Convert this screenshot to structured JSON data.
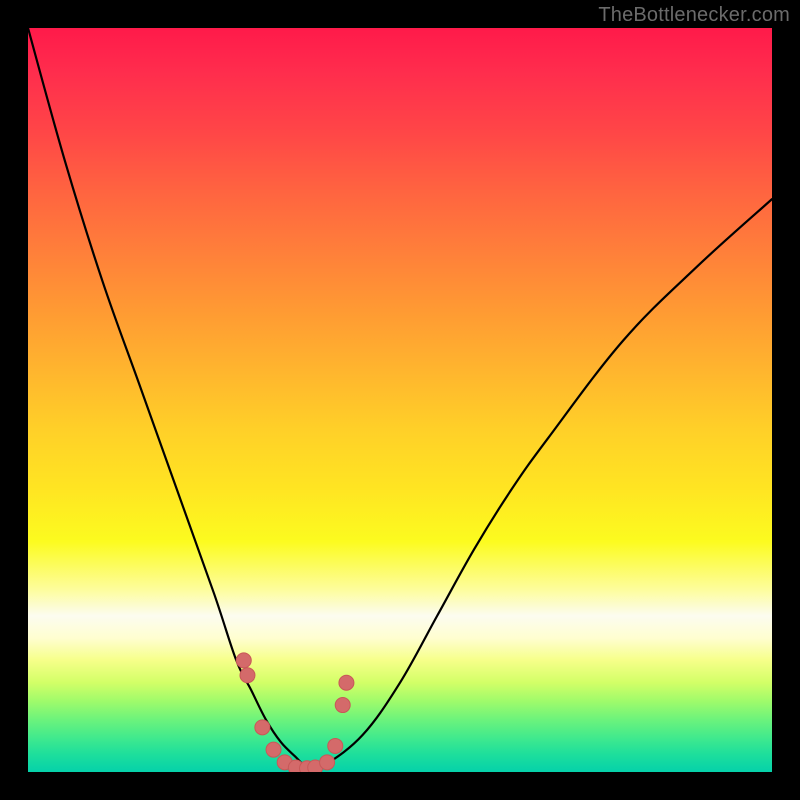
{
  "watermark": {
    "text": "TheBottlenecker.com"
  },
  "colors": {
    "curve_stroke": "#000000",
    "marker_fill": "#d46a6a",
    "marker_stroke": "#c85858",
    "frame_bg": "#000000"
  },
  "chart_data": {
    "type": "line",
    "title": "",
    "xlabel": "",
    "ylabel": "",
    "xlim": [
      0,
      100
    ],
    "ylim": [
      0,
      100
    ],
    "grid": false,
    "legend": false,
    "description": "V-shaped bottleneck curve on vertical rainbow gradient (red top → green bottom). Curve minimum sits near bottom center; salmon markers cluster near the trough.",
    "series": [
      {
        "name": "bottleneck-curve",
        "x": [
          0,
          5,
          10,
          15,
          20,
          25,
          28,
          30,
          32,
          34,
          36,
          37,
          38,
          40,
          45,
          50,
          55,
          60,
          65,
          70,
          80,
          90,
          100
        ],
        "y": [
          100,
          82,
          66,
          52,
          38,
          24,
          15,
          11,
          7,
          4,
          2,
          1,
          0.5,
          1,
          5,
          12,
          21,
          30,
          38,
          45,
          58,
          68,
          77
        ]
      }
    ],
    "markers": {
      "name": "trough-markers",
      "x": [
        29.0,
        29.5,
        31.5,
        33.0,
        34.5,
        36.0,
        37.5,
        38.6,
        40.2,
        41.3,
        42.3,
        42.8
      ],
      "y": [
        15.0,
        13.0,
        6.0,
        3.0,
        1.3,
        0.6,
        0.5,
        0.6,
        1.3,
        3.5,
        9.0,
        12.0
      ]
    }
  }
}
